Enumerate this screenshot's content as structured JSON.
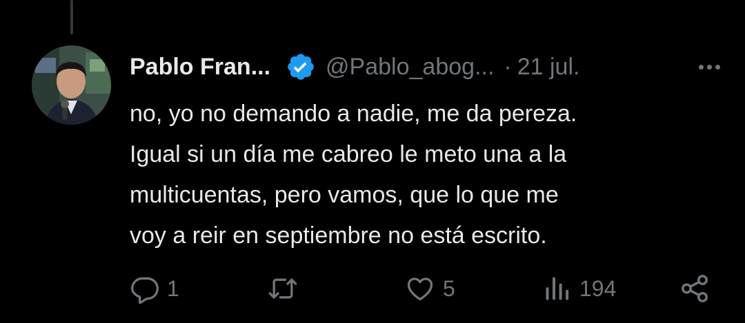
{
  "tweet": {
    "author_name": "Pablo Fran...",
    "handle": "@Pablo_abog...",
    "separator": "·",
    "date": "21 jul.",
    "text_lines": [
      "no, yo no demando a nadie, me da pereza.",
      "Igual si un día me cabreo le meto una a la",
      "multicuentas, pero vamos, que lo que me",
      "voy a reir en septiembre no está escrito."
    ]
  },
  "actions": {
    "reply_count": "1",
    "retweet_count": "",
    "like_count": "5",
    "views_count": "194"
  },
  "icons": {
    "verified": "verified-badge-icon",
    "more": "more-options-icon",
    "reply": "reply-icon",
    "retweet": "retweet-icon",
    "like": "heart-icon",
    "views": "views-icon",
    "share": "share-icon"
  },
  "colors": {
    "background": "#000000",
    "text": "#e7e9ea",
    "secondary": "#71767b",
    "verified": "#1d9bf0"
  }
}
